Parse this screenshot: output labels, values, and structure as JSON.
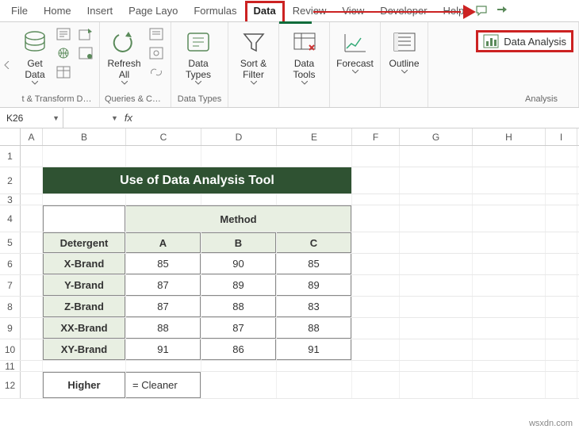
{
  "tabs": {
    "file": "File",
    "home": "Home",
    "insert": "Insert",
    "page_layout": "Page Layo",
    "formulas": "Formulas",
    "data": "Data",
    "review": "Review",
    "view": "View",
    "developer": "Developer",
    "help": "Help"
  },
  "ribbon": {
    "get_data": "Get\nData",
    "refresh_all": "Refresh\nAll",
    "data_types": "Data\nTypes",
    "sort_filter": "Sort &\nFilter",
    "data_tools": "Data\nTools",
    "forecast": "Forecast",
    "outline": "Outline",
    "data_analysis": "Data Analysis",
    "groups": {
      "get_transform": "t & Transform D…",
      "queries": "Queries & Co…",
      "data_types": "Data Types",
      "analysis": "Analysis"
    }
  },
  "namebox": "K26",
  "fx_label": "fx",
  "columns": [
    "A",
    "B",
    "C",
    "D",
    "E",
    "F",
    "G",
    "H",
    "I"
  ],
  "row_numbers": [
    "1",
    "2",
    "3",
    "4",
    "5",
    "6",
    "7",
    "8",
    "9",
    "10",
    "11",
    "12"
  ],
  "content": {
    "title": "Use of Data Analysis Tool",
    "method_header": "Method",
    "detergent_header": "Detergent",
    "col_a": "A",
    "col_b": "B",
    "col_c": "C",
    "rows": [
      {
        "name": "X-Brand",
        "a": "85",
        "b": "90",
        "c": "85"
      },
      {
        "name": "Y-Brand",
        "a": "87",
        "b": "89",
        "c": "89"
      },
      {
        "name": "Z-Brand",
        "a": "87",
        "b": "88",
        "c": "83"
      },
      {
        "name": "XX-Brand",
        "a": "88",
        "b": "87",
        "c": "88"
      },
      {
        "name": "XY-Brand",
        "a": "91",
        "b": "86",
        "c": "91"
      }
    ],
    "legend_higher": "Higher",
    "legend_cleaner": "= Cleaner"
  },
  "watermark": "wsxdn.com"
}
